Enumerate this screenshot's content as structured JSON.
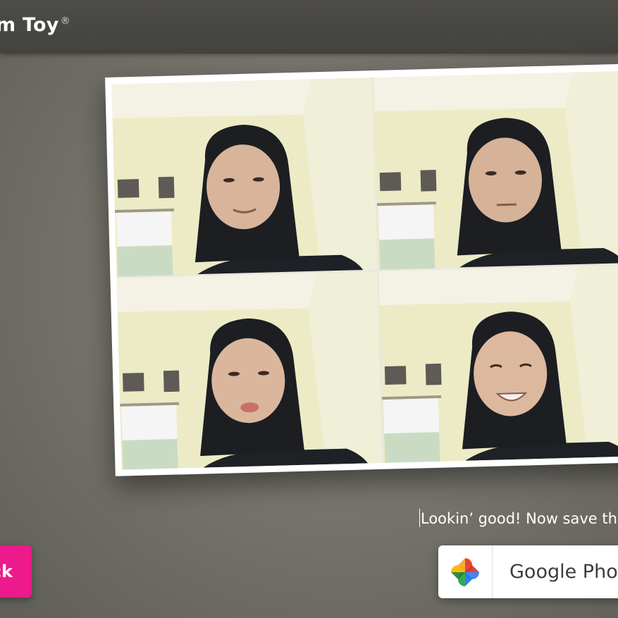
{
  "app": {
    "brand": "m Toy",
    "registered_mark": "®"
  },
  "photo_strip": {
    "frames": [
      {
        "id": "frame-1",
        "expression": "slight smile"
      },
      {
        "id": "frame-2",
        "expression": "neutral"
      },
      {
        "id": "frame-3",
        "expression": "tongue out"
      },
      {
        "id": "frame-4",
        "expression": "big smile"
      }
    ]
  },
  "caption": {
    "text": "Lookin’ good! Now save thi"
  },
  "back_button": {
    "label": "ck"
  },
  "save_button": {
    "label": "Google Pho",
    "icon": "google-photos-icon"
  },
  "colors": {
    "accent": "#ec1a8a",
    "topbar": "#4a4945",
    "background": "#77756d"
  }
}
